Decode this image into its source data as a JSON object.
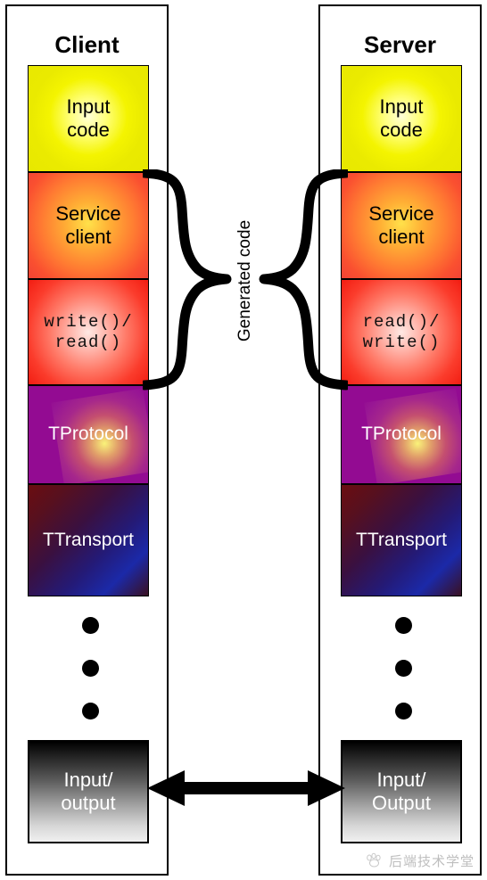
{
  "diagram": {
    "title_client": "Client",
    "title_server": "Server",
    "generated_code_label": "Generated code"
  },
  "client": {
    "layers": [
      {
        "id": "input-code",
        "label": "Input\ncode",
        "color": "#f0f000"
      },
      {
        "id": "service",
        "label": "Service\nclient",
        "color": "#ff7a32"
      },
      {
        "id": "rw",
        "label": "write()/\nread()",
        "color": "#fb3c2c"
      },
      {
        "id": "tprotocol",
        "label": "TProtocol",
        "color": "#930b92"
      },
      {
        "id": "ttransport",
        "label": "TTransport",
        "color": "#241a77"
      }
    ],
    "io_label": "Input/\noutput",
    "ellipsis_dots": 3
  },
  "server": {
    "layers": [
      {
        "id": "input-code",
        "label": "Input\ncode",
        "color": "#f0f000"
      },
      {
        "id": "service",
        "label": "Service\nclient",
        "color": "#ff7a32"
      },
      {
        "id": "rw",
        "label": "read()/\nwrite()",
        "color": "#fb3c2c"
      },
      {
        "id": "tprotocol",
        "label": "TProtocol",
        "color": "#930b92"
      },
      {
        "id": "ttransport",
        "label": "TTransport",
        "color": "#241a77"
      }
    ],
    "io_label": "Input/\nOutput",
    "ellipsis_dots": 3
  },
  "connector": {
    "arrow_name": "bidirectional-arrow",
    "brace_left_name": "left-curly-brace",
    "brace_right_name": "right-curly-brace"
  },
  "watermark": {
    "text": "后端技术学堂",
    "icon": "paw-icon"
  },
  "colors": {
    "frame_border": "#000000",
    "background": "#ffffff",
    "brace": "#000000",
    "arrow": "#000000"
  }
}
